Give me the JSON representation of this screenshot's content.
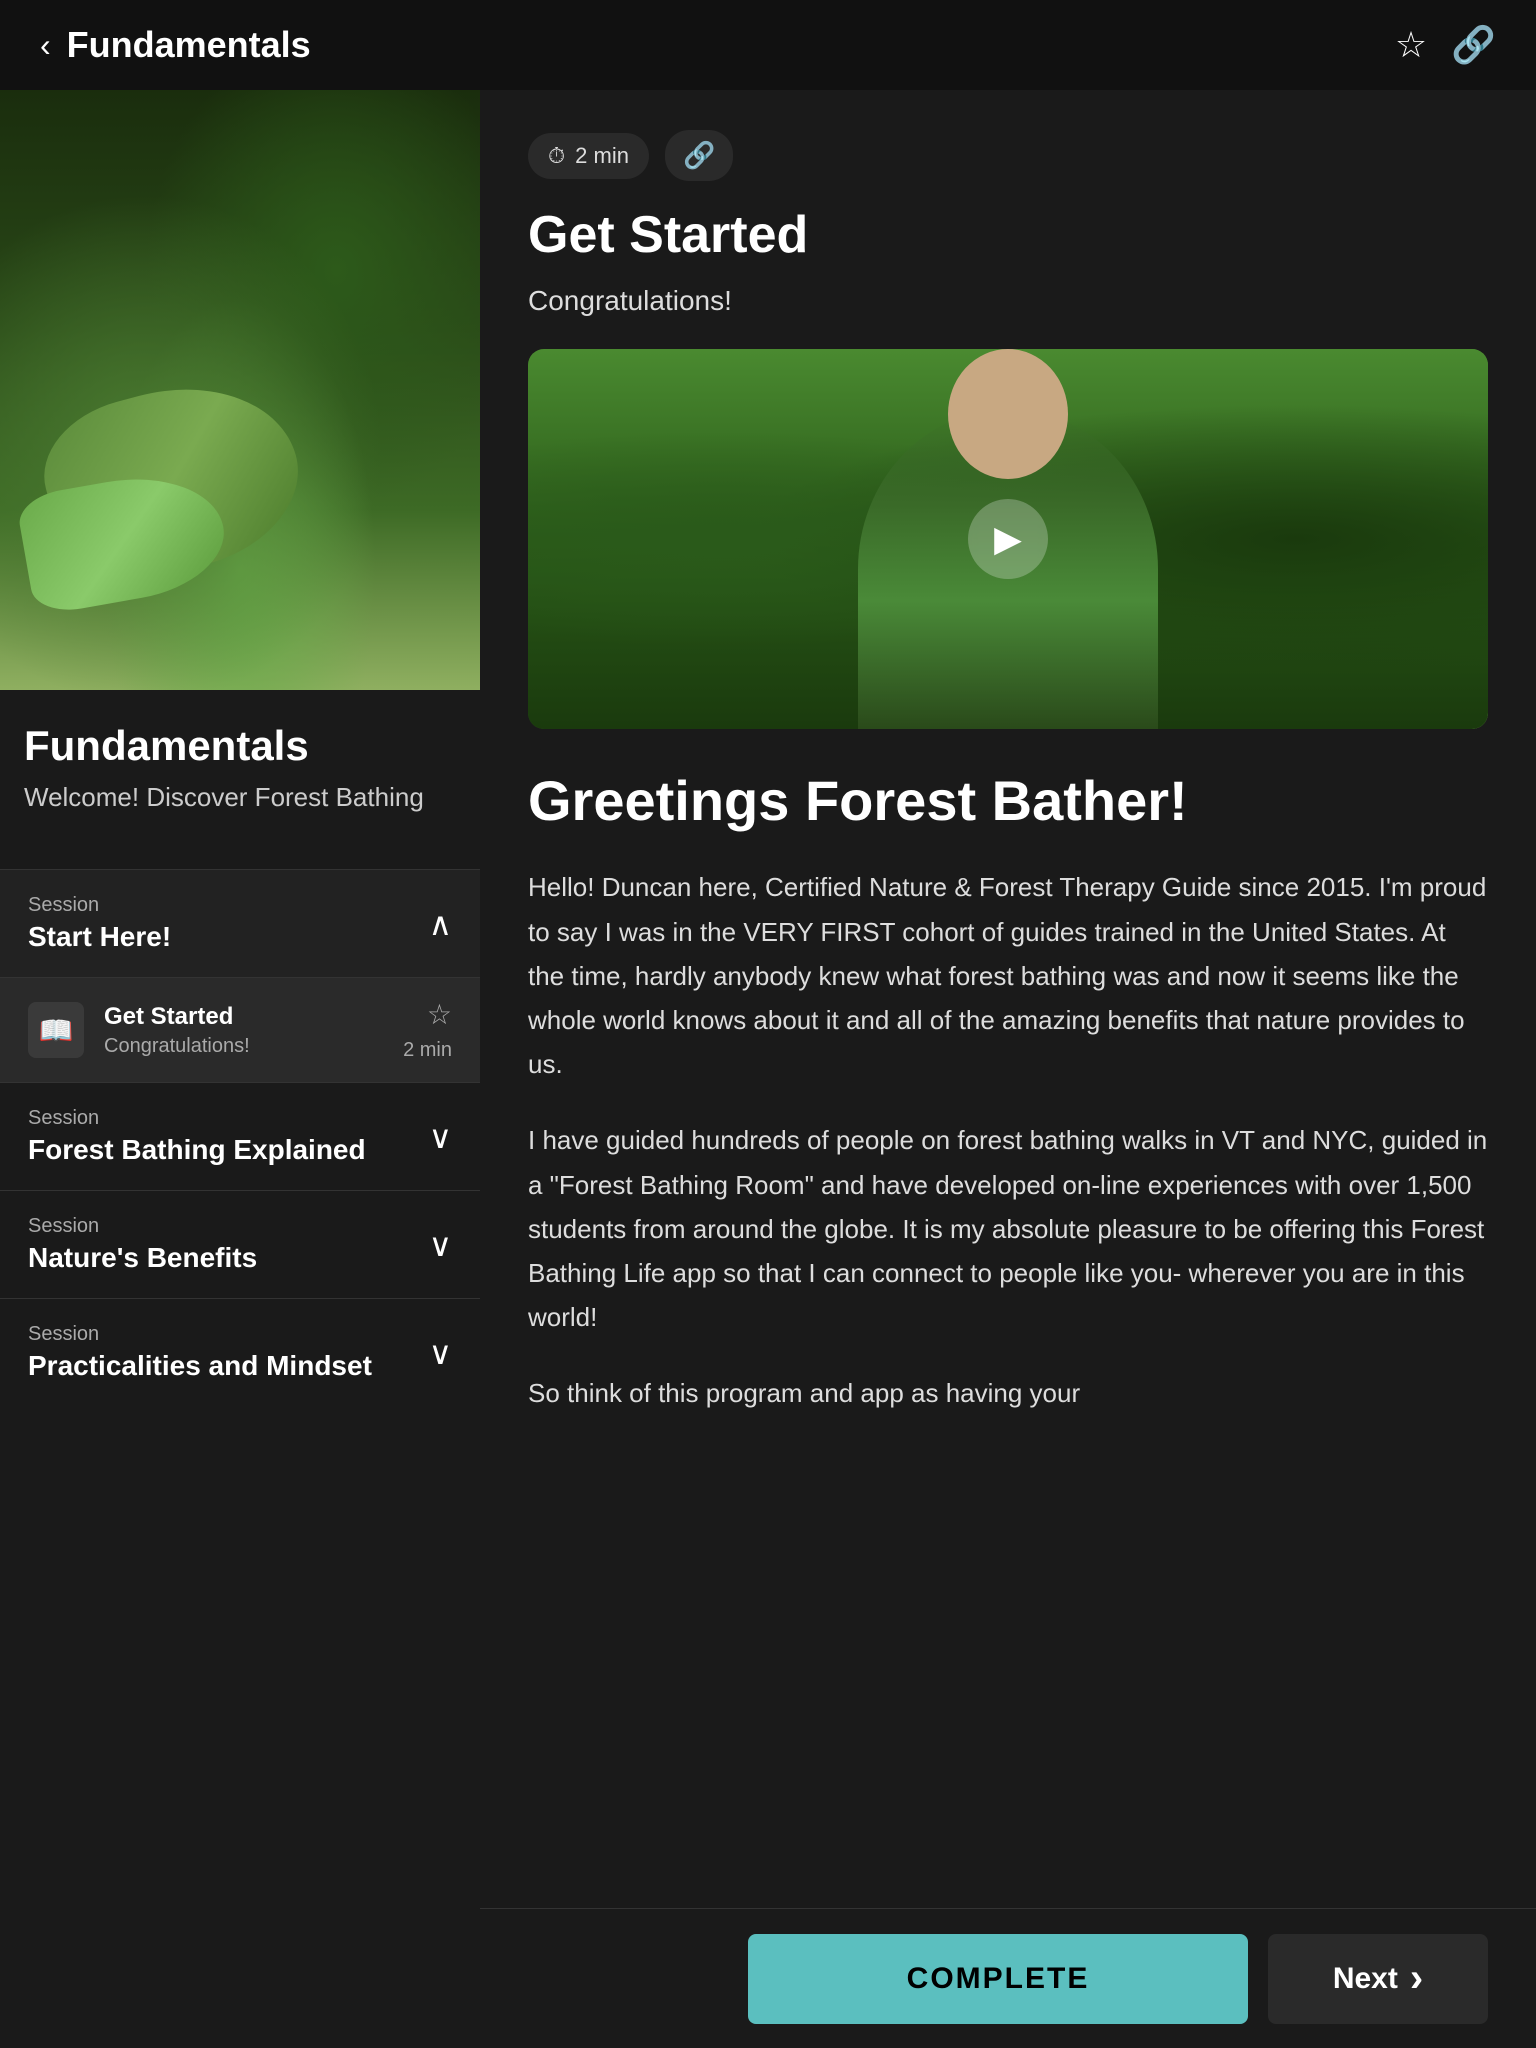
{
  "header": {
    "back_label": "‹",
    "title": "Fundamentals",
    "bookmark_icon": "☆",
    "share_icon": "🔗"
  },
  "course": {
    "title": "Fundamentals",
    "subtitle": "Welcome!  Discover Forest Bathing"
  },
  "sessions": [
    {
      "id": "start-here",
      "label": "Session",
      "name": "Start Here!",
      "expanded": true,
      "lessons": [
        {
          "icon": "📖",
          "title": "Get Started",
          "subtitle": "Congratulations!",
          "duration": "2 min",
          "active": true
        }
      ]
    },
    {
      "id": "forest-bathing-explained",
      "label": "Session",
      "name": "Forest Bathing Explained",
      "expanded": false,
      "lessons": []
    },
    {
      "id": "natures-benefits",
      "label": "Session",
      "name": "Nature's Benefits",
      "expanded": false,
      "lessons": []
    },
    {
      "id": "practicalities-mindset",
      "label": "Session",
      "name": "Practicalities and Mindset",
      "expanded": false,
      "lessons": []
    }
  ],
  "lesson": {
    "duration": "2 min",
    "title": "Get Started",
    "congratulations": "Congratulations!",
    "video_alt": "Instructor in forest",
    "greeting_title": "Greetings Forest Bather!",
    "body_paragraph_1": "Hello! Duncan here, Certified Nature & Forest Therapy Guide since 2015. I'm proud to say I was in the VERY FIRST cohort of guides trained in the United States. At the time, hardly anybody knew what forest bathing was and now it seems like the whole world knows about it and all of the amazing benefits that nature provides to us.",
    "body_paragraph_2": "I have guided hundreds of people on forest bathing walks in VT and NYC, guided in a \"Forest Bathing Room\" and have developed on-line experiences with over 1,500 students from around the globe. It is my absolute pleasure to be offering this Forest Bathing Life app so that I can connect to people like you- wherever you are in this world!",
    "body_paragraph_3": "So think of this program and app as having your",
    "complete_label": "COMPLETE",
    "next_label": "Next"
  }
}
